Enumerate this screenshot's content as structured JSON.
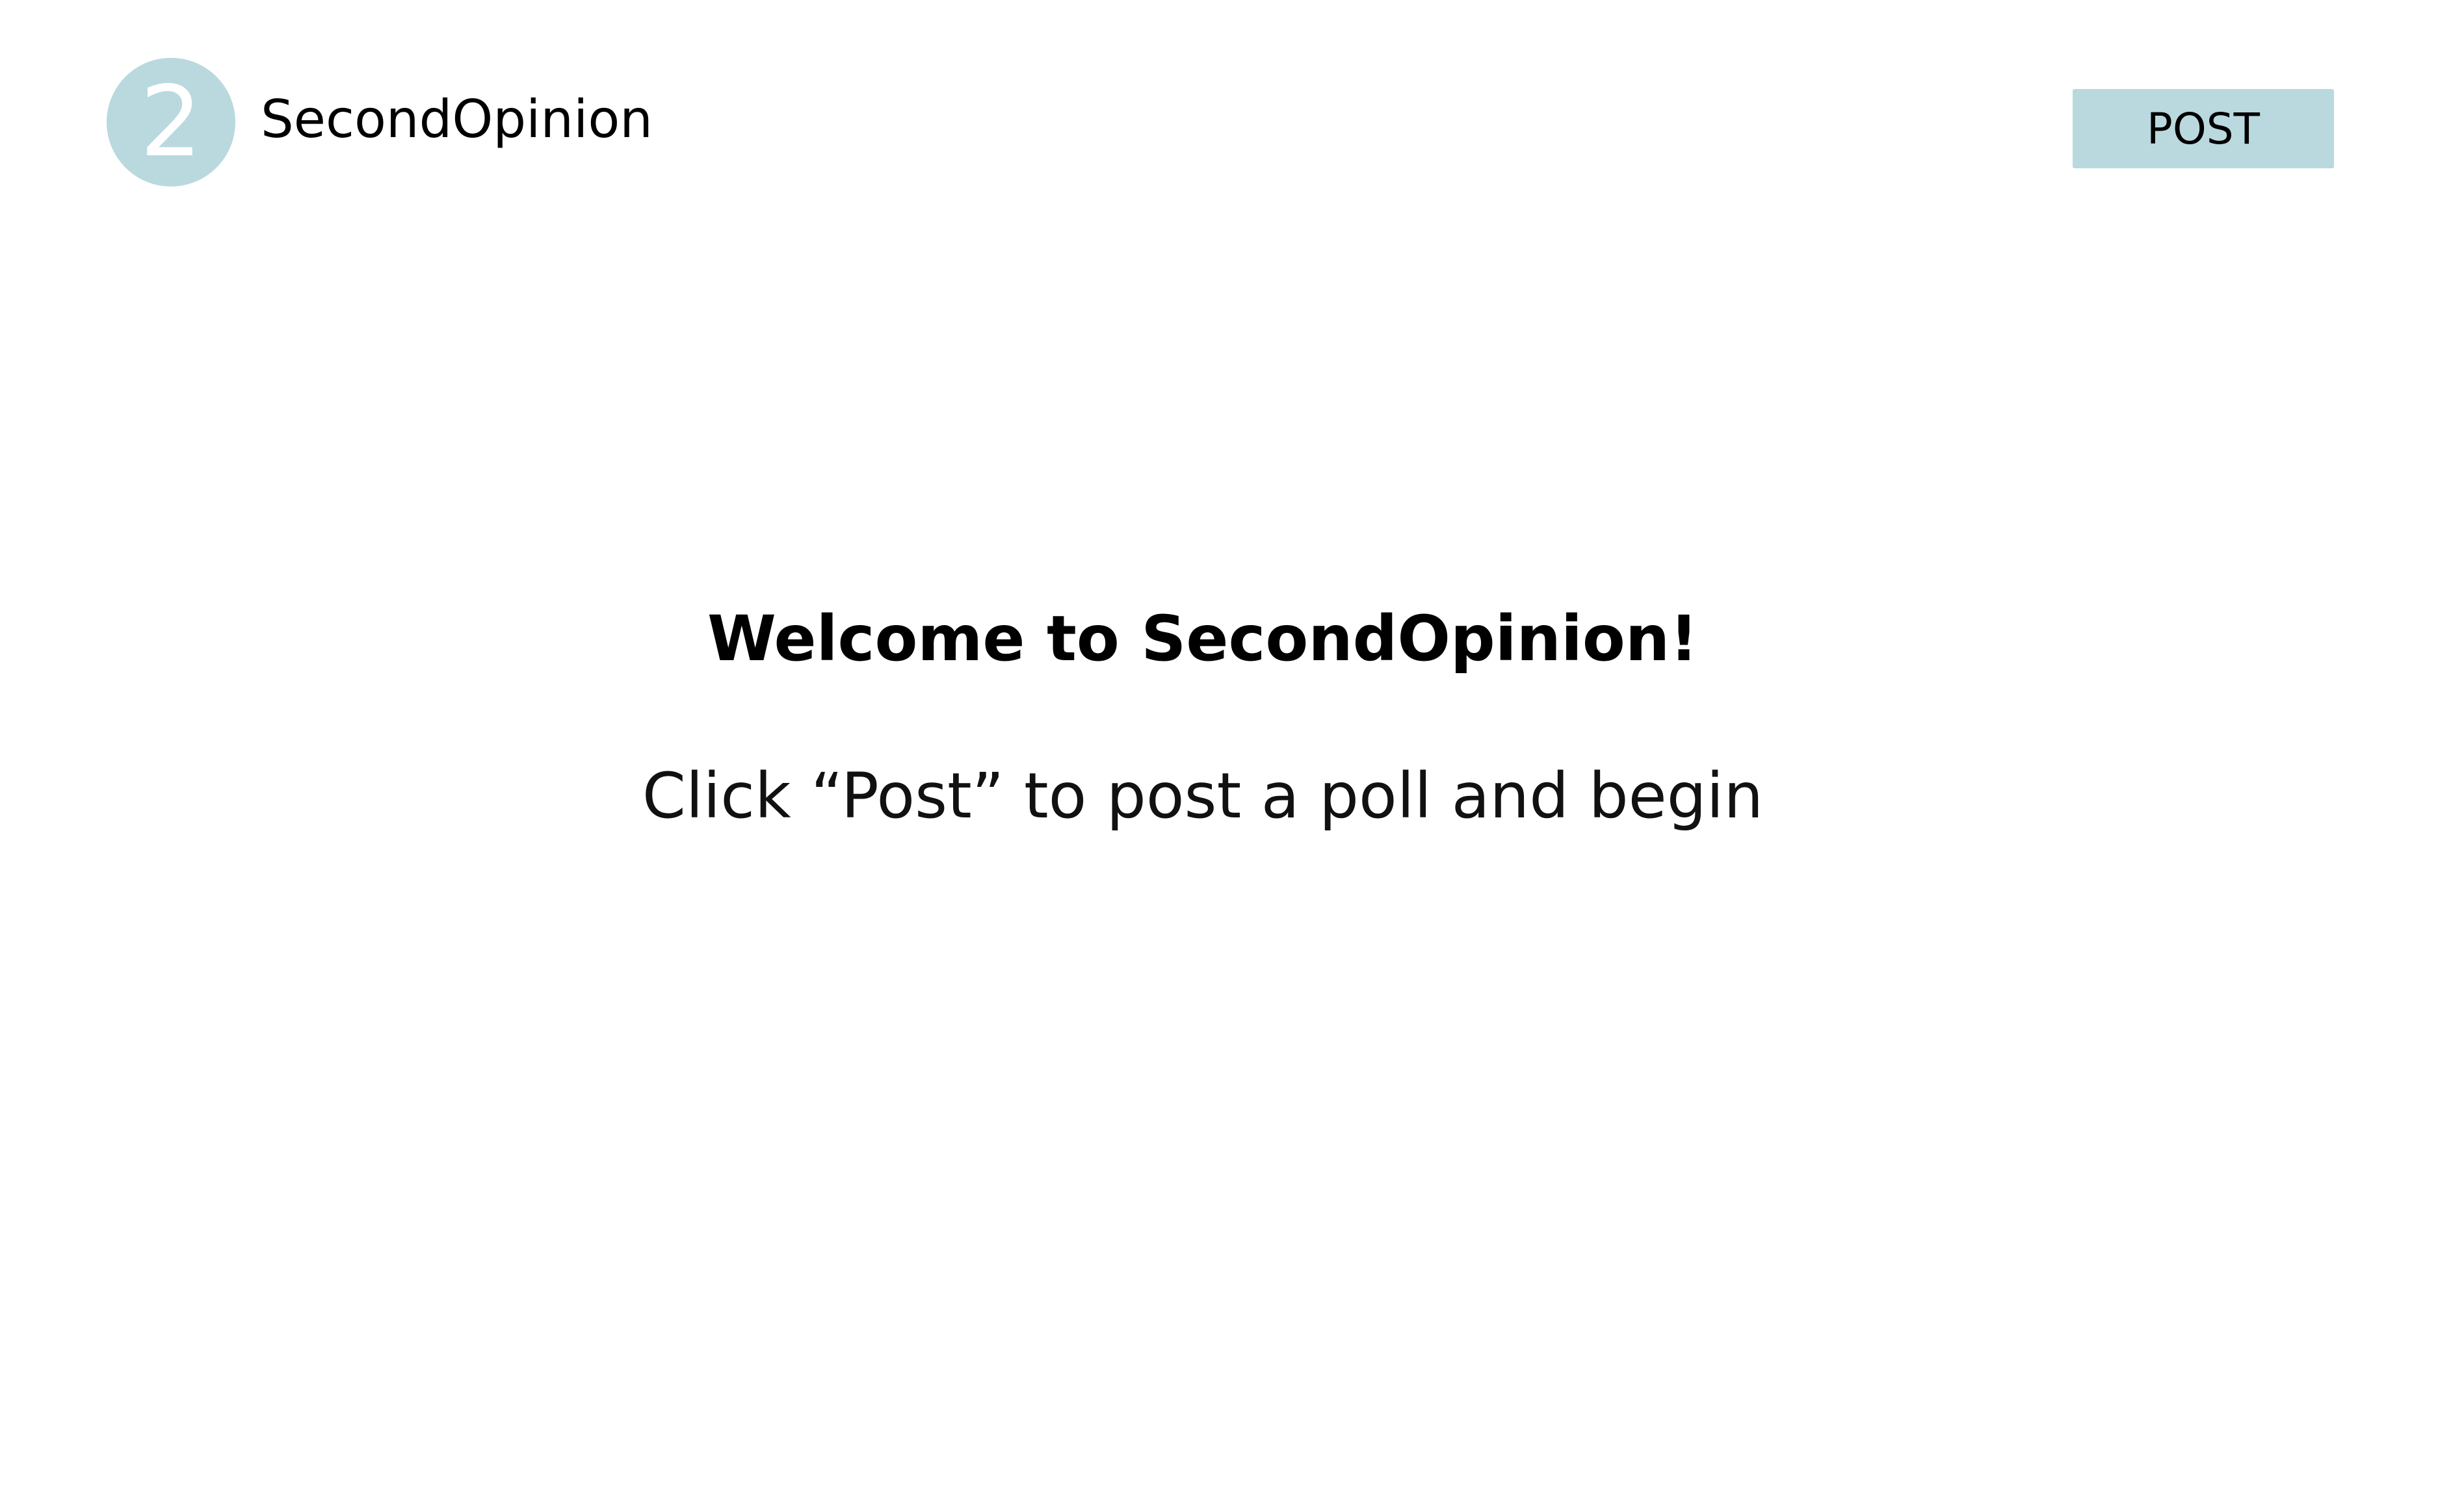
{
  "header": {
    "logo_text": "2",
    "app_name": "SecondOpinion",
    "post_button_label": "POST"
  },
  "main": {
    "welcome_heading": "Welcome to SecondOpinion!",
    "instruction": "Click “Post” to post a poll and begin"
  },
  "colors": {
    "accent": "#b9d9de",
    "text": "#000000",
    "background": "#ffffff"
  }
}
